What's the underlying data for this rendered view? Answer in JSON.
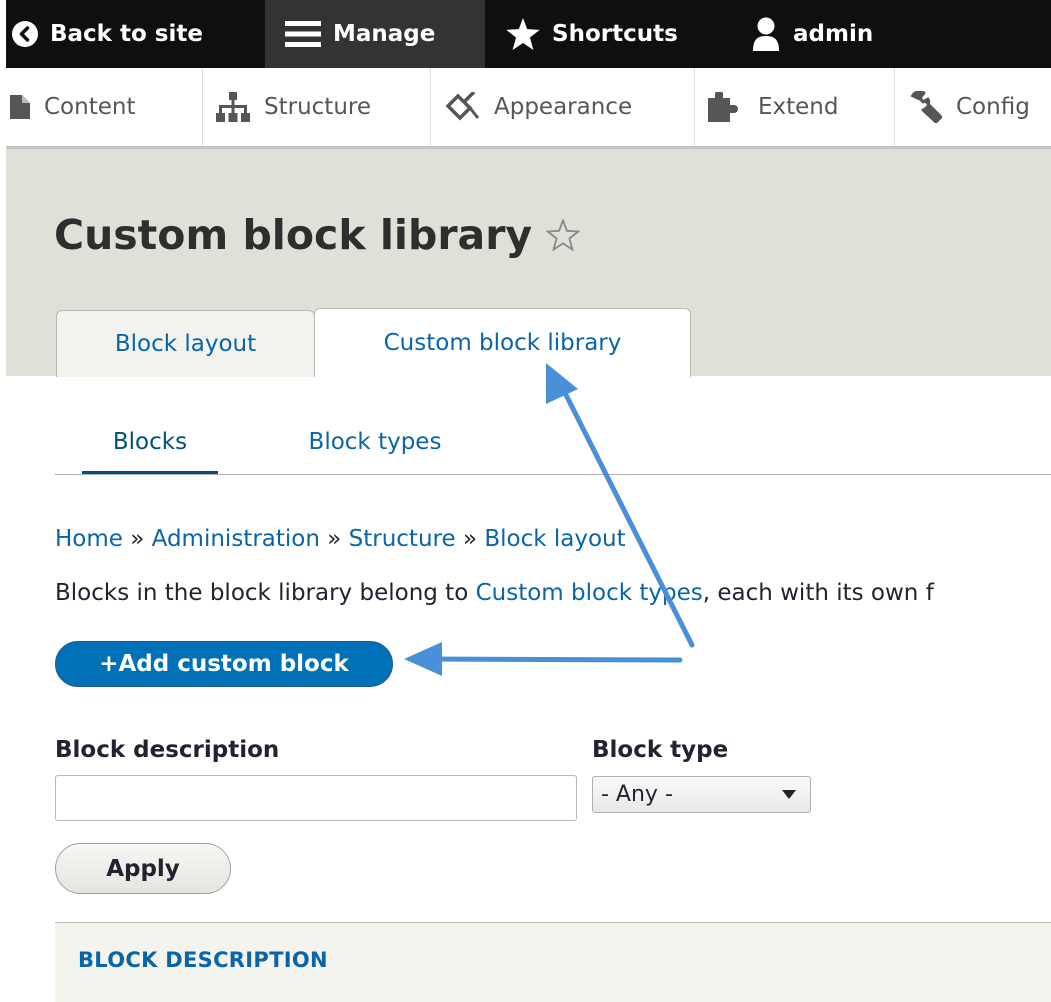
{
  "toolbar": {
    "back_label": "Back to site",
    "manage_label": "Manage",
    "shortcuts_label": "Shortcuts",
    "user_label": "admin"
  },
  "tray": {
    "items": [
      {
        "label": "Content",
        "icon": "file-icon"
      },
      {
        "label": "Structure",
        "icon": "sitemap-icon"
      },
      {
        "label": "Appearance",
        "icon": "paint-brush-icon"
      },
      {
        "label": "Extend",
        "icon": "puzzle-icon"
      },
      {
        "label": "Config",
        "icon": "wrench-icon"
      }
    ]
  },
  "page": {
    "title": "Custom block library",
    "primary_tabs": [
      {
        "label": "Block layout",
        "active": false
      },
      {
        "label": "Custom block library",
        "active": true
      }
    ],
    "secondary_tabs": [
      {
        "label": "Blocks",
        "active": true
      },
      {
        "label": "Block types",
        "active": false
      }
    ]
  },
  "breadcrumb": {
    "items": [
      "Home",
      "Administration",
      "Structure",
      "Block layout"
    ],
    "separator": "»"
  },
  "description": {
    "before": "Blocks in the block library belong to ",
    "link": "Custom block types",
    "after": ", each with its own f"
  },
  "actions": {
    "add_label": "+Add custom block"
  },
  "filters": {
    "description_label": "Block description",
    "description_value": "",
    "type_label": "Block type",
    "type_selected": "- Any -",
    "apply_label": "Apply"
  },
  "table": {
    "header": "BLOCK DESCRIPTION"
  },
  "colors": {
    "link": "#0a64a8",
    "button_primary": "#0071b8",
    "annotation_arrow": "#4a90d9",
    "toolbar_bg": "#0f0f0f"
  }
}
